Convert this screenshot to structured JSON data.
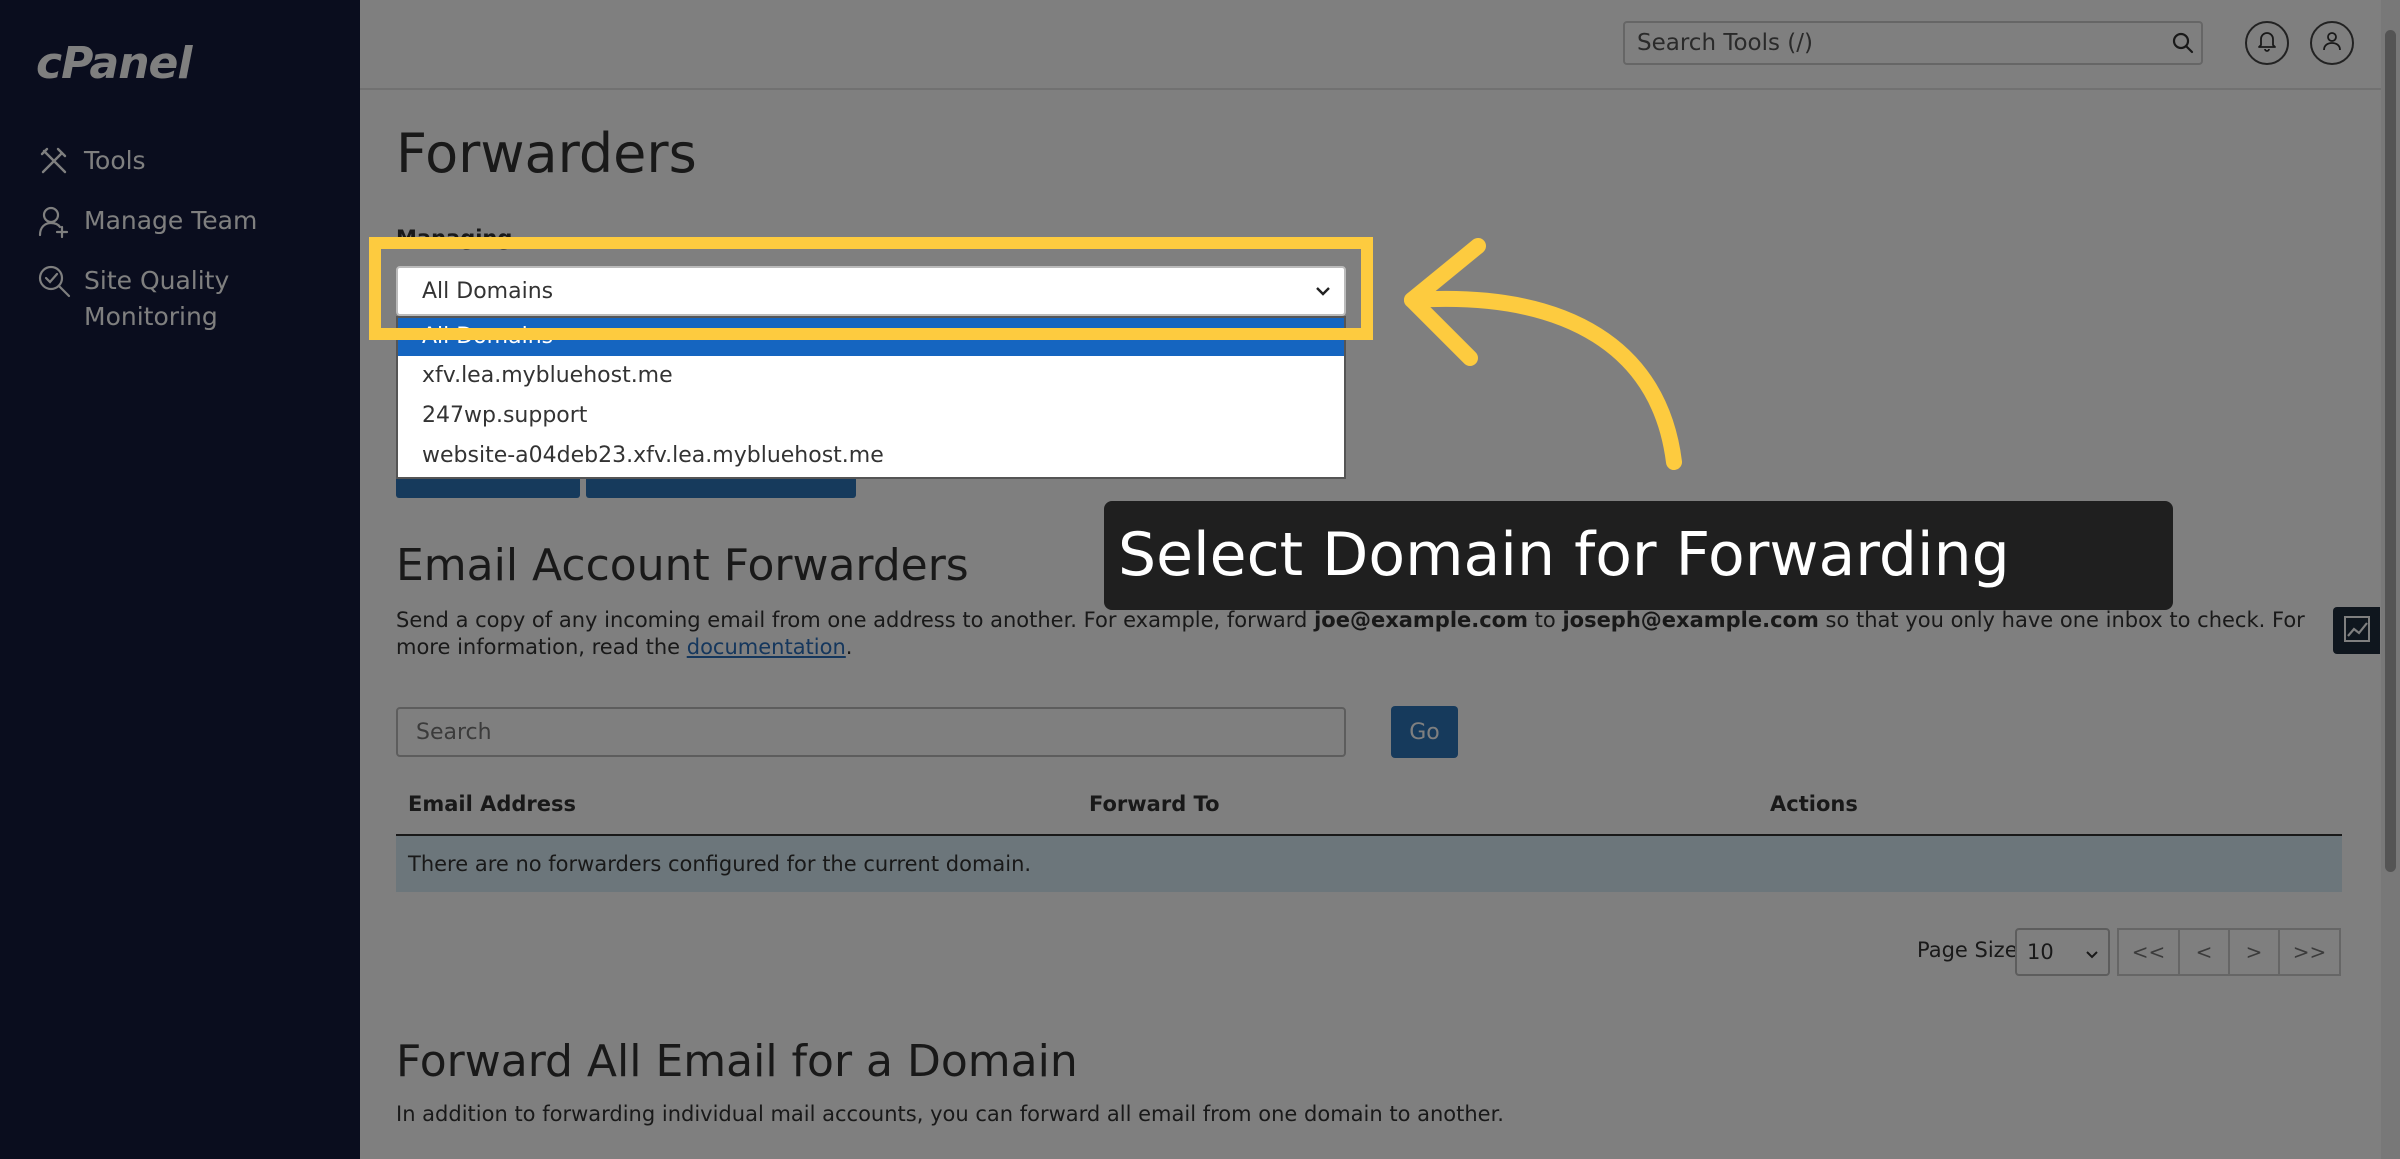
{
  "sidebar": {
    "logo": "cPanel",
    "items": [
      {
        "label": "Tools",
        "icon": "tools-icon"
      },
      {
        "label": "Manage Team",
        "icon": "team-icon"
      },
      {
        "label": "Site Quality\nMonitoring",
        "icon": "site-quality-icon"
      }
    ]
  },
  "header": {
    "search_placeholder": "Search Tools (/)",
    "icons": [
      "search-icon",
      "bell-icon",
      "user-icon"
    ]
  },
  "page": {
    "title": "Forwarders",
    "managing_label": "Managing",
    "selected_domain": "All Domains",
    "domain_options": [
      "All Domains",
      "xfv.lea.mybluehost.me",
      "247wp.support",
      "website-a04deb23.xfv.lea.mybluehost.me"
    ]
  },
  "email_forwarders": {
    "heading": "Email Account Forwarders",
    "desc_1": "Send a copy of any incoming email from one address to another. For example, forward ",
    "desc_bold_1": "joe@example.com",
    "desc_2": " to ",
    "desc_bold_2": "joseph@example.com",
    "desc_3": " so that you only have one inbox to check. For more information, read the ",
    "desc_link": "documentation",
    "desc_4": ".",
    "search_placeholder": "Search",
    "go_label": "Go",
    "columns": [
      "Email Address",
      "Forward To",
      "Actions"
    ],
    "empty_message": "There are no forwarders configured for the current domain.",
    "page_size_label": "Page Size",
    "page_size_value": "10",
    "pager": [
      "<<",
      "<",
      ">",
      ">>"
    ]
  },
  "domain_forwarders": {
    "heading": "Forward All Email for a Domain",
    "desc": "In addition to forwarding individual mail accounts, you can forward all email from one domain to another."
  },
  "tooltip": {
    "text": "Select Domain for Forwarding"
  },
  "colors": {
    "sidebar_bg": "#141a3d",
    "accent_blue": "#2d75b9",
    "highlight_yellow": "#fdcb3f",
    "tooltip_bg": "#1f1f1f",
    "selected_option_bg": "#1565c0"
  }
}
